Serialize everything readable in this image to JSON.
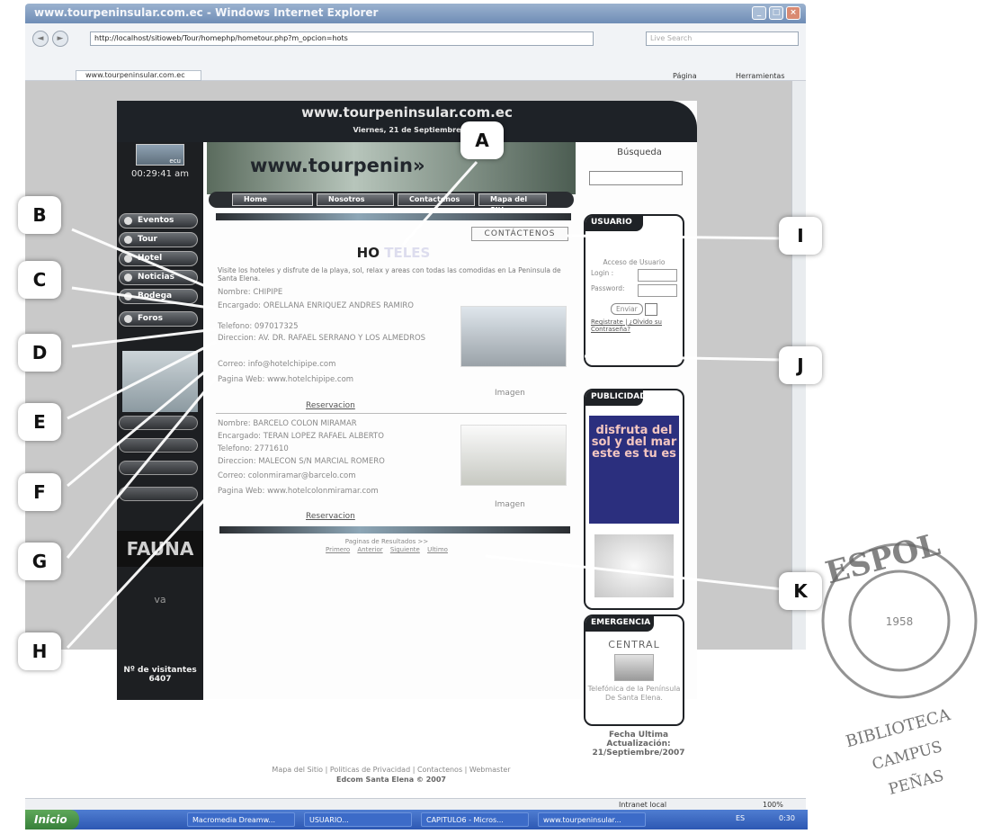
{
  "browser": {
    "title": "www.tourpeninsular.com.ec - Windows Internet Explorer",
    "url": "http://localhost/sitioweb/Tour/homephp/hometour.php?m_opcion=hots",
    "search_placeholder": "Live Search",
    "tab_label": "www.tourpeninsular.com.ec",
    "tools": {
      "page": "Página",
      "tools": "Herramientas"
    },
    "status": {
      "zone": "Intranet local",
      "zoom": "100%"
    }
  },
  "site": {
    "banner_url": "www.tourpeninsular.com.ec",
    "date": "Viernes, 21 de Septiembre",
    "clock": "00:29:41 am",
    "clock_img": "ecu",
    "header_logo": "www.tourpenin»",
    "menu": [
      "Eventos",
      "Tour",
      "Hotel",
      "Noticias",
      "Bodega",
      "Foros"
    ],
    "nav": [
      "Home",
      "Nosotros",
      "Contactenos",
      "Mapa del Sitio"
    ],
    "search_label": "Búsqueda",
    "contact_button": "CONTÁCTENOS",
    "title_a": "HO",
    "title_b": "TELES",
    "intro": "Visite los hoteles y disfrute de la playa, sol, relax y areas con todas las comodidas en La Peninsula de Santa Elena.",
    "hotels": [
      {
        "name": "Nombre: CHIPIPE",
        "encargado": "Encargado: ORELLANA ENRIQUEZ ANDRES RAMIRO",
        "telefono": "Telefono: 097017325",
        "direccion": "Direccion: AV. DR. RAFAEL SERRANO Y LOS ALMEDROS",
        "correo": "Correo: info@hotelchipipe.com",
        "web": "Pagina Web: www.hotelchipipe.com",
        "image_label": "Imagen",
        "reserve": "Reservacion"
      },
      {
        "name": "Nombre: BARCELO COLON MIRAMAR",
        "encargado": "Encargado: TERAN LOPEZ RAFAEL ALBERTO",
        "telefono": "Telefono: 2771610",
        "direccion": "Direccion: MALECON S/N MARCIAL ROMERO",
        "correo": "Correo: colonmiramar@barcelo.com",
        "web": "Pagina Web: www.hotelcolonmiramar.com",
        "image_label": "Imagen",
        "reserve": "Reservacion"
      }
    ],
    "pager_label": "Paginas de Resultados >>",
    "pager": [
      "Primero",
      "Anterior",
      "Siguiente",
      "Ultimo"
    ],
    "user_box": {
      "title": "USUARIO",
      "access": "Acceso de Usuario",
      "login": "Login :",
      "password": "Password:",
      "send": "Enviar",
      "register": "Registrate",
      "forgot": "¿Olvido su Contraseña?"
    },
    "pub_box": {
      "title": "PUBLICIDAD",
      "ad_text": "disfruta del sol y del mar este es tu es"
    },
    "emergency": {
      "title": "EMERGENCIA",
      "central": "CENTRAL",
      "text": "Telefónica de la Península De Santa Elena."
    },
    "fecha": "Fecha Ultima Actualización: 21/Septiembre/2007",
    "fauna": "FAUNA",
    "fauna_sub": "va",
    "visitors": "Nº de visitantes 6407",
    "footer_links": "Mapa del Sitio | Politicas de Privacidad | Contactenos | Webmaster",
    "footer_copy": "Edcom Santa Elena © 2007"
  },
  "taskbar": {
    "start": "Inicio",
    "tasks": [
      "Macromedia Dreamw...",
      "USUARIO...",
      "CAPITULO6 - Micros...",
      "www.tourpeninsular..."
    ],
    "lang": "ES",
    "time": "0:30"
  },
  "callouts": [
    "A",
    "B",
    "C",
    "D",
    "E",
    "F",
    "G",
    "H",
    "I",
    "J",
    "K"
  ],
  "stamp": {
    "top": "ESPOL",
    "year": "1958",
    "bottom": "BIBLIOTECA CAMPUS PEÑAS"
  }
}
